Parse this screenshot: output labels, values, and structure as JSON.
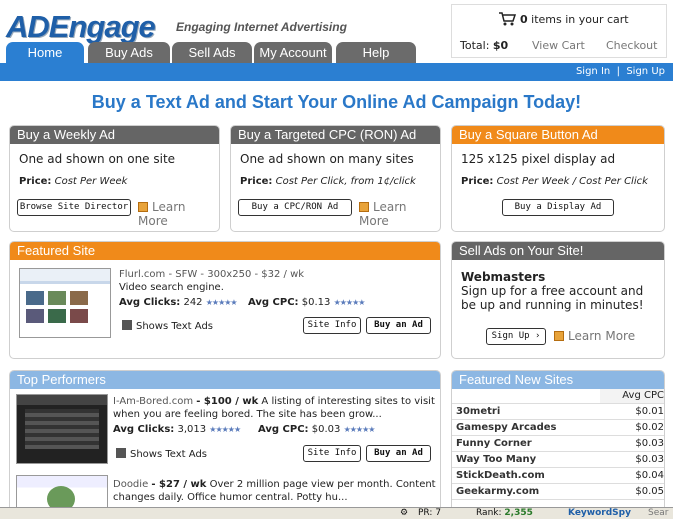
{
  "brand": {
    "logo": "ADEngage",
    "tagline": "Engaging Internet Advertising"
  },
  "cart": {
    "count": "0",
    "count_label": "items in your cart",
    "total_label": "Total:",
    "total_value": "$0",
    "view_cart": "View Cart",
    "checkout": "Checkout"
  },
  "tabs": [
    "Home",
    "Buy Ads",
    "Sell Ads",
    "My Account",
    "Help"
  ],
  "auth": {
    "sign_in": "Sign In",
    "sep": "|",
    "sign_up": "Sign Up"
  },
  "headline": "Buy a Text Ad and Start Your Online Ad Campaign Today!",
  "offers": [
    {
      "title": "Buy a Weekly Ad",
      "desc": "One ad shown on one site",
      "price_label": "Price:",
      "price_value": "Cost Per Week",
      "button": "Browse Site Director",
      "learn": "Learn More"
    },
    {
      "title": "Buy a Targeted CPC (RON) Ad",
      "desc": "One ad shown on many sites",
      "price_label": "Price:",
      "price_value": "Cost Per Click, from 1¢/click",
      "button": "Buy a CPC/RON Ad",
      "learn": "Learn More"
    },
    {
      "title": "Buy a Square Button Ad",
      "desc": "125 x125 pixel display ad",
      "price_label": "Price:",
      "price_value": "Cost Per Week / Cost Per Click",
      "button": "Buy a Display Ad"
    }
  ],
  "featured": {
    "title": "Featured Site",
    "site": "Flurl.com - SFW - 300x250 - $32 / wk",
    "desc": "Video search engine.",
    "avg_clicks_label": "Avg Clicks:",
    "avg_clicks": "242",
    "avg_cpc_label": "Avg CPC:",
    "avg_cpc": "$0.13",
    "shows": "Shows Text Ads",
    "site_info": "Site Info",
    "buy": "Buy an Ad"
  },
  "sell": {
    "title": "Sell Ads on Your Site!",
    "heading": "Webmasters",
    "text": "Sign up for a free account and be up and running in minutes!",
    "signup": "Sign Up",
    "learn": "Learn More"
  },
  "top": {
    "title": "Top Performers",
    "items": [
      {
        "name": "I-Am-Bored.com",
        "price": "- $100 / wk",
        "desc": "A listing of interesting sites to visit when you are feeling bored. The site has been grow...",
        "avg_clicks_label": "Avg Clicks:",
        "avg_clicks": "3,013",
        "avg_cpc_label": "Avg CPC:",
        "avg_cpc": "$0.03",
        "shows": "Shows Text Ads",
        "site_info": "Site Info",
        "buy": "Buy an Ad"
      },
      {
        "name": "Doodie",
        "price": "- $27 / wk",
        "desc": "Over 2 million page view per month. Content changes daily. Office humor central. Potty hu..."
      }
    ]
  },
  "new_sites": {
    "title": "Featured New Sites",
    "col": "Avg CPC",
    "rows": [
      {
        "name": "30metri",
        "cpc": "$0.01"
      },
      {
        "name": "Gamespy Arcades",
        "cpc": "$0.02"
      },
      {
        "name": "Funny Corner",
        "cpc": "$0.03"
      },
      {
        "name": "Way Too Many",
        "cpc": "$0.03"
      },
      {
        "name": "StickDeath.com",
        "cpc": "$0.04"
      },
      {
        "name": "Geekarmy.com",
        "cpc": "$0.05"
      }
    ]
  },
  "statusbar": {
    "pr": "PR:",
    "pr_val": "7",
    "rank": "Rank:",
    "rank_val": "2,355",
    "spy": "KeywordSpy",
    "search": "Sear"
  }
}
